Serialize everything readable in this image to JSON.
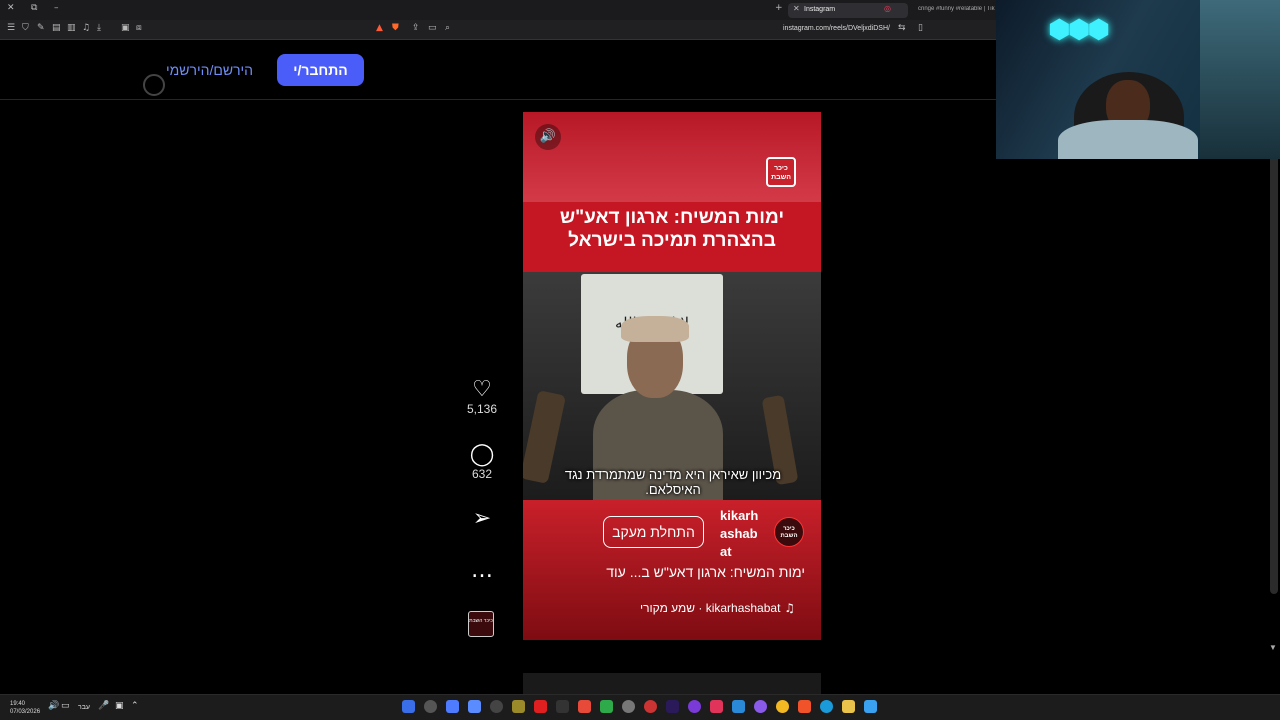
{
  "browser": {
    "active_tab_title": "Instagram",
    "other_tab_title": "cringe #funny #relatable | TikT",
    "url": "instagram.com/reels/DVeljxdiDSH/"
  },
  "header": {
    "login_label": "התחבר/י",
    "signup_label": "הירשם/הירשמי"
  },
  "reel": {
    "logo_text": "כיכר השבת",
    "headline": "ימות המשיח: ארגון דאע\"ש בהצהרת תמיכה בישראל",
    "flag_text": "لا إله إلا الله",
    "subtitle": "מכיוון שאיראן היא מדינה שמתמרדת נגד האיסלאם.",
    "follow_label": "התחלת מעקב",
    "username": "kikarhashabat",
    "avatar_text": "כיכר השבת",
    "caption": "ימות המשיח: ארגון דאע\"ש ב... עוד",
    "audio": "kikarhashabat · שמע מקורי",
    "sound_icon": "speaker-icon"
  },
  "actions": {
    "likes": "5,136",
    "comments": "632",
    "thumb_text": "כיכר השבת"
  },
  "taskbar": {
    "time": "19:40",
    "date": "07/03/2026",
    "lang": "עבר"
  }
}
